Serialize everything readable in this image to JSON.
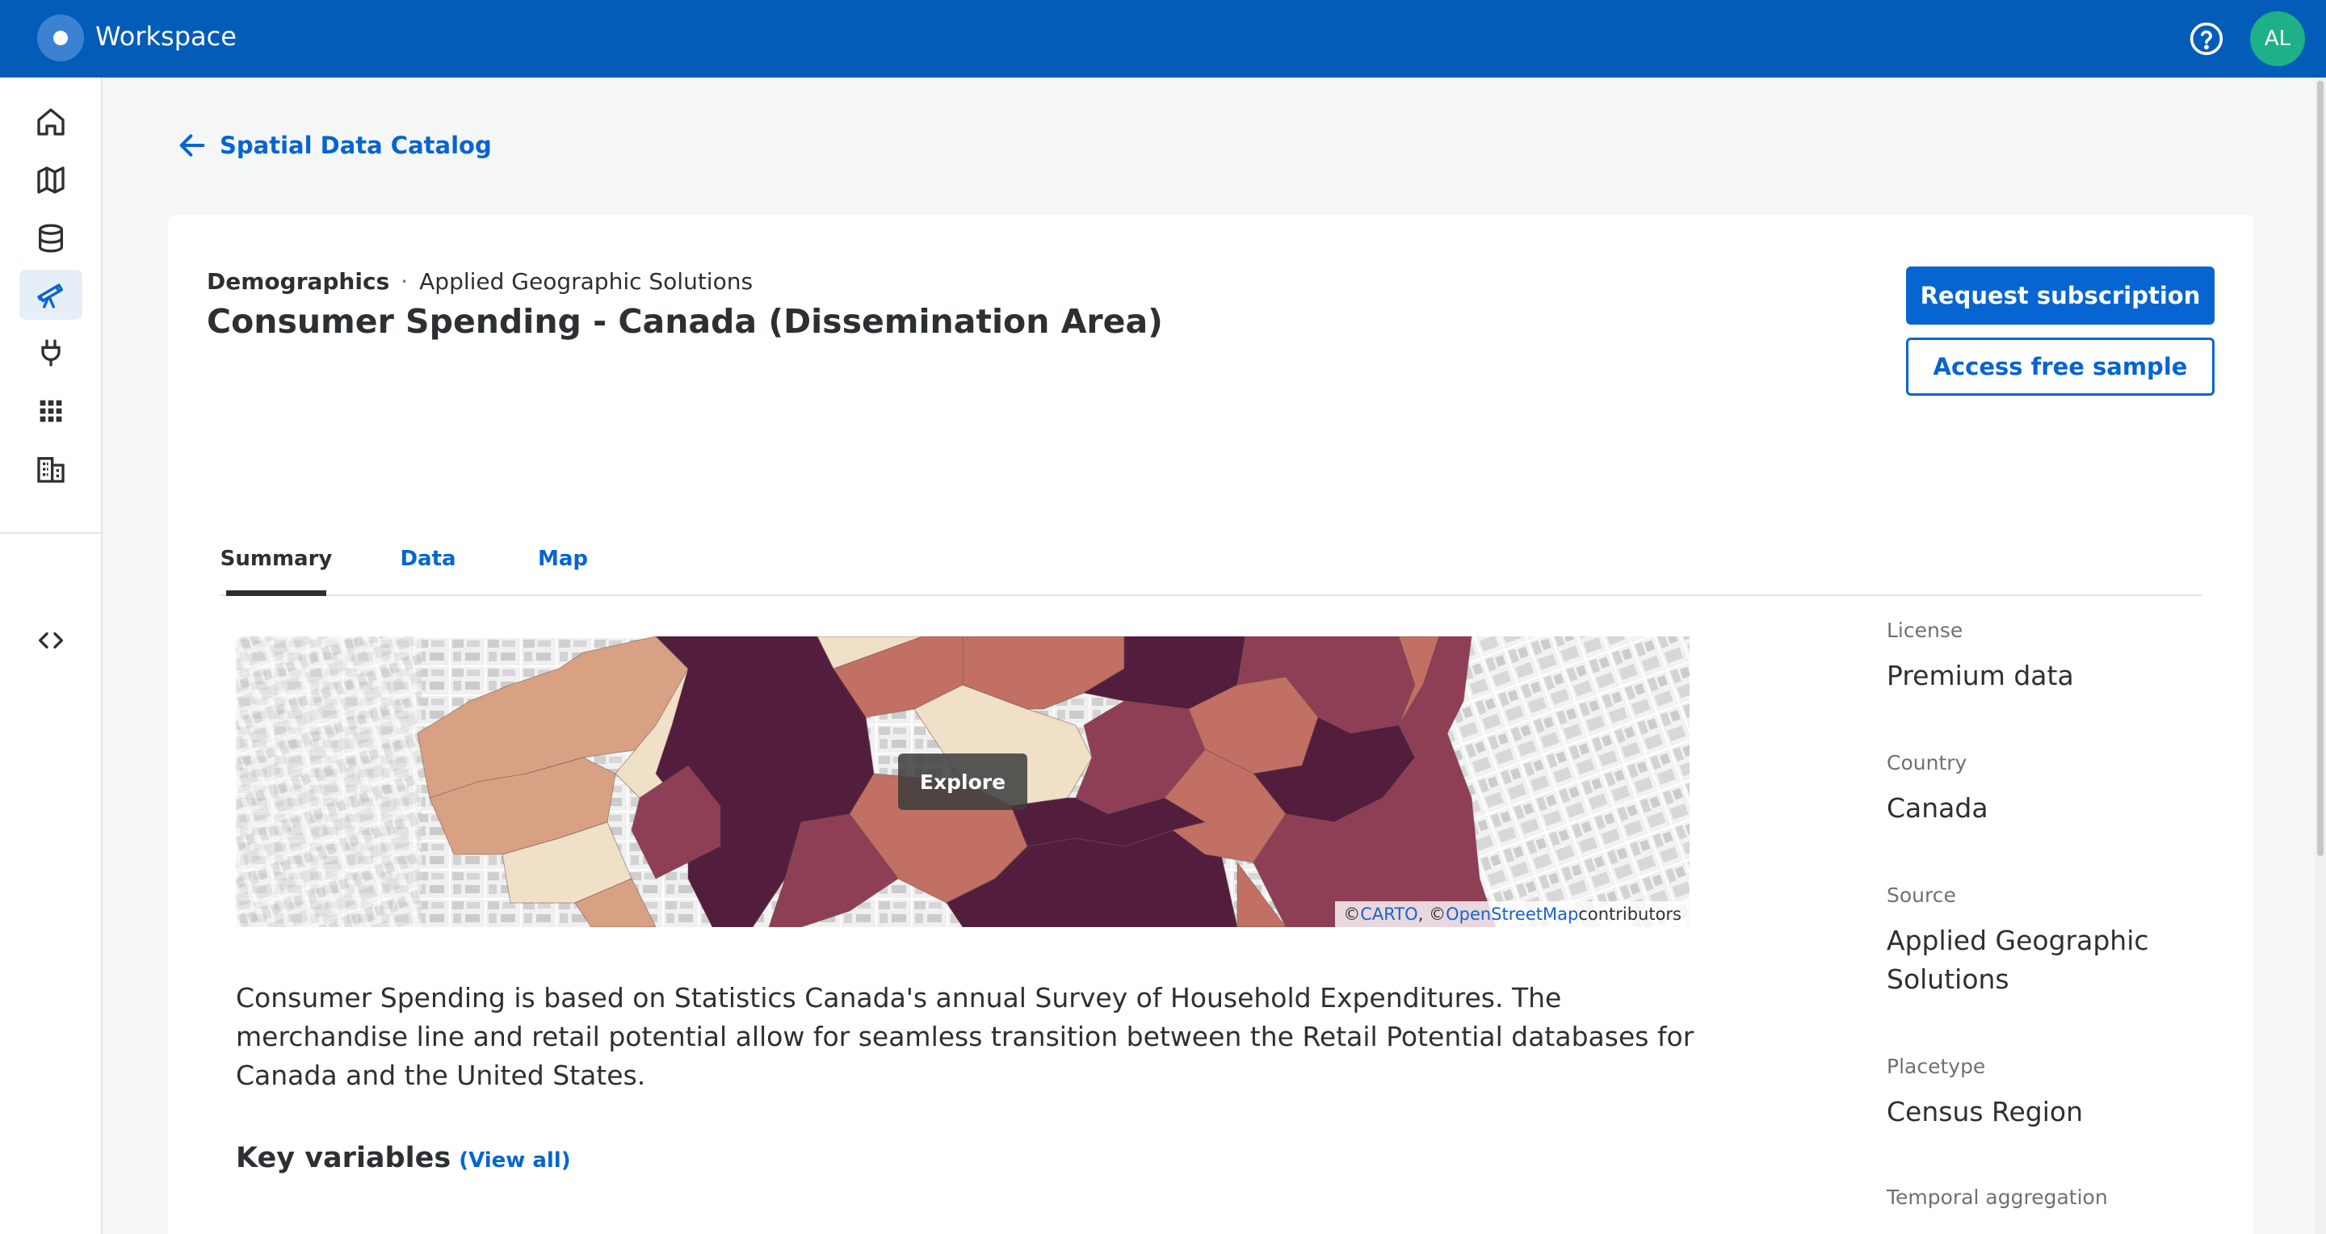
{
  "app": {
    "title": "Workspace",
    "avatar_initials": "AL",
    "brand_color": "#035cb8",
    "accent_color": "#0665d0"
  },
  "sidebar": {
    "items": [
      {
        "icon": "home-icon",
        "active": false
      },
      {
        "icon": "map-icon",
        "active": false
      },
      {
        "icon": "database-icon",
        "active": false
      },
      {
        "icon": "telescope-icon",
        "active": true
      },
      {
        "icon": "plug-icon",
        "active": false
      },
      {
        "icon": "apps-grid-icon",
        "active": false
      },
      {
        "icon": "building-icon",
        "active": false
      }
    ],
    "bottom_icon": "code-icon"
  },
  "breadcrumb": {
    "back_label": "Spatial Data Catalog"
  },
  "dataset": {
    "category": "Demographics",
    "separator": "·",
    "provider": "Applied Geographic Solutions",
    "title": "Consumer Spending - Canada (Dissemination Area)",
    "description": "Consumer Spending is based on Statistics Canada's annual Survey of Household Expenditures. The merchandise line and retail potential allow for seamless transition between the Retail Potential databases for Canada and the United States."
  },
  "actions": {
    "request_label": "Request subscription",
    "sample_label": "Access free sample"
  },
  "tabs": [
    {
      "label": "Summary",
      "active": true
    },
    {
      "label": "Data",
      "active": false
    },
    {
      "label": "Map",
      "active": false
    }
  ],
  "map_preview": {
    "explore_label": "Explore",
    "attribution": {
      "prefix": "© ",
      "carto": "CARTO",
      "mid": ", © ",
      "osm": "OpenStreetMap",
      "suffix": " contributors"
    },
    "palette": [
      "#531d3e",
      "#8f3f55",
      "#c27063",
      "#d9a183",
      "#efe0c7"
    ]
  },
  "key_variables": {
    "title": "Key variables",
    "view_all": "(View all)"
  },
  "metadata": [
    {
      "label": "License",
      "value": "Premium data"
    },
    {
      "label": "Country",
      "value": "Canada"
    },
    {
      "label": "Source",
      "value": "Applied Geographic Solutions"
    },
    {
      "label": "Placetype",
      "value": "Census Region"
    },
    {
      "label": "Temporal aggregation",
      "value": ""
    }
  ]
}
